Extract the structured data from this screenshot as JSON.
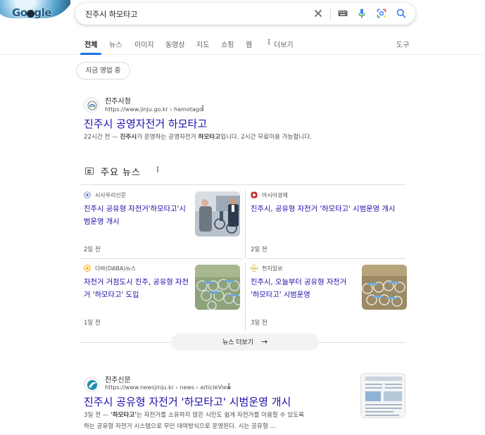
{
  "header": {
    "logo_text": "Google",
    "search_query": "진주시 하모타고",
    "icons": [
      "close-icon",
      "keyboard-icon",
      "mic-icon",
      "lens-icon",
      "search-icon"
    ]
  },
  "tabs": [
    {
      "label": "전체",
      "active": true
    },
    {
      "label": "뉴스"
    },
    {
      "label": "이미지"
    },
    {
      "label": "동영상"
    },
    {
      "label": "지도"
    },
    {
      "label": "쇼핑"
    },
    {
      "label": "웹"
    },
    {
      "label": "더보기"
    }
  ],
  "tools_label": "도구",
  "filter_chip": "지금 영업 중",
  "result1": {
    "site_name": "진주시청",
    "url": "https://www.jinju.go.kr › hamotago",
    "title": "진주시 공영자전거 하모타고",
    "snippet_time": "22시간 전 — ",
    "snippet_b1": "진주시",
    "snippet_mid": "가 운영하는 공영자전거 ",
    "snippet_b2": "하모타고",
    "snippet_end": "입니다. 2시간 무료이용 가능합니다."
  },
  "top_stories": {
    "heading": "주요 뉴스",
    "cards": [
      {
        "source": "시사우리신문",
        "title": "진주시 공유형 자전거'하모타고'시범운영 개시",
        "time": "2일 전"
      },
      {
        "source": "아시아경제",
        "title": "진주시, 공유형 자전거 '하모타고' 시범운영 개시",
        "time": "2일 전"
      },
      {
        "source": "다바(DABA)뉴스",
        "title": "자전거 거점도시 진주, 공유형 자전거 '하모타고' 도입",
        "time": "1일 전"
      },
      {
        "source": "천지일보",
        "title": "진주시, 오늘부터 공유형 자전거 '하모타고' 시범운영",
        "time": "3일 전"
      }
    ],
    "more_label": "뉴스 더보기"
  },
  "result2": {
    "site_name": "진주신문",
    "url": "https://www.newsjinju.kr › news › articleView",
    "title": "진주시 공유형 자전거 '하모타고' 시범운영 개시",
    "snippet_line1_time": "3일 전 — ",
    "snippet_line1_b": "'하모타고'",
    "snippet_line1_rest": "는 자전거를 소유하지 않은 시민도 쉽게 자전거를 이용할 수 있도록",
    "snippet_line2": "하는 공유형 자전거 시스템으로 무인 대여방식으로 운영된다. 시는 공유형 ..."
  },
  "colors": {
    "link": "#1a0dab",
    "accent": "#1a73e8",
    "text_secondary": "#4d5156"
  }
}
